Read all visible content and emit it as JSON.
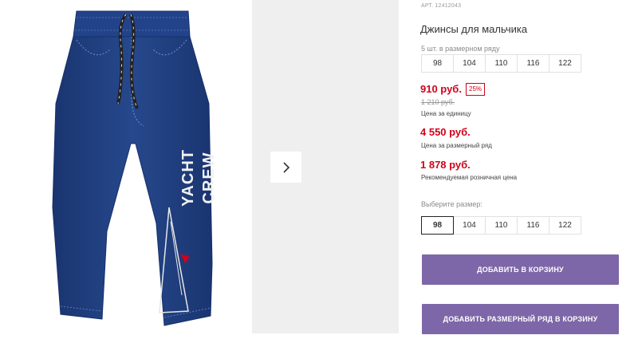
{
  "product": {
    "sku_label": "АРТ. 12412043",
    "title": "Джинсы для мальчика",
    "image_print_text": "YACHT CREW"
  },
  "size_range": {
    "hint": "5 шт. в размерном ряду",
    "sizes": [
      "98",
      "104",
      "110",
      "116",
      "122"
    ]
  },
  "prices": {
    "unit_price": "910 руб.",
    "discount_badge": "25%",
    "old_price": "1 210 руб.",
    "unit_label": "Цена за единицу",
    "range_price": "4 550 руб.",
    "range_label": "Цена за размерный ряд",
    "retail_price": "1 878 руб.",
    "retail_label": "Рекомендуемая розничная цена"
  },
  "size_select": {
    "hint": "Выберите размер:",
    "sizes": [
      "98",
      "104",
      "110",
      "116",
      "122"
    ],
    "selected": "98"
  },
  "buttons": {
    "add_to_cart": "ДОБАВИТЬ В КОРЗИНУ",
    "add_range_to_cart": "ДОБАВИТЬ РАЗМЕРНЫЙ РЯД В КОРЗИНУ"
  },
  "colors": {
    "price_red": "#d0021b",
    "button_purple": "#7d67a8",
    "denim_blue": "#1f3e7a"
  },
  "icons": {
    "next": "chevron-right-icon"
  }
}
